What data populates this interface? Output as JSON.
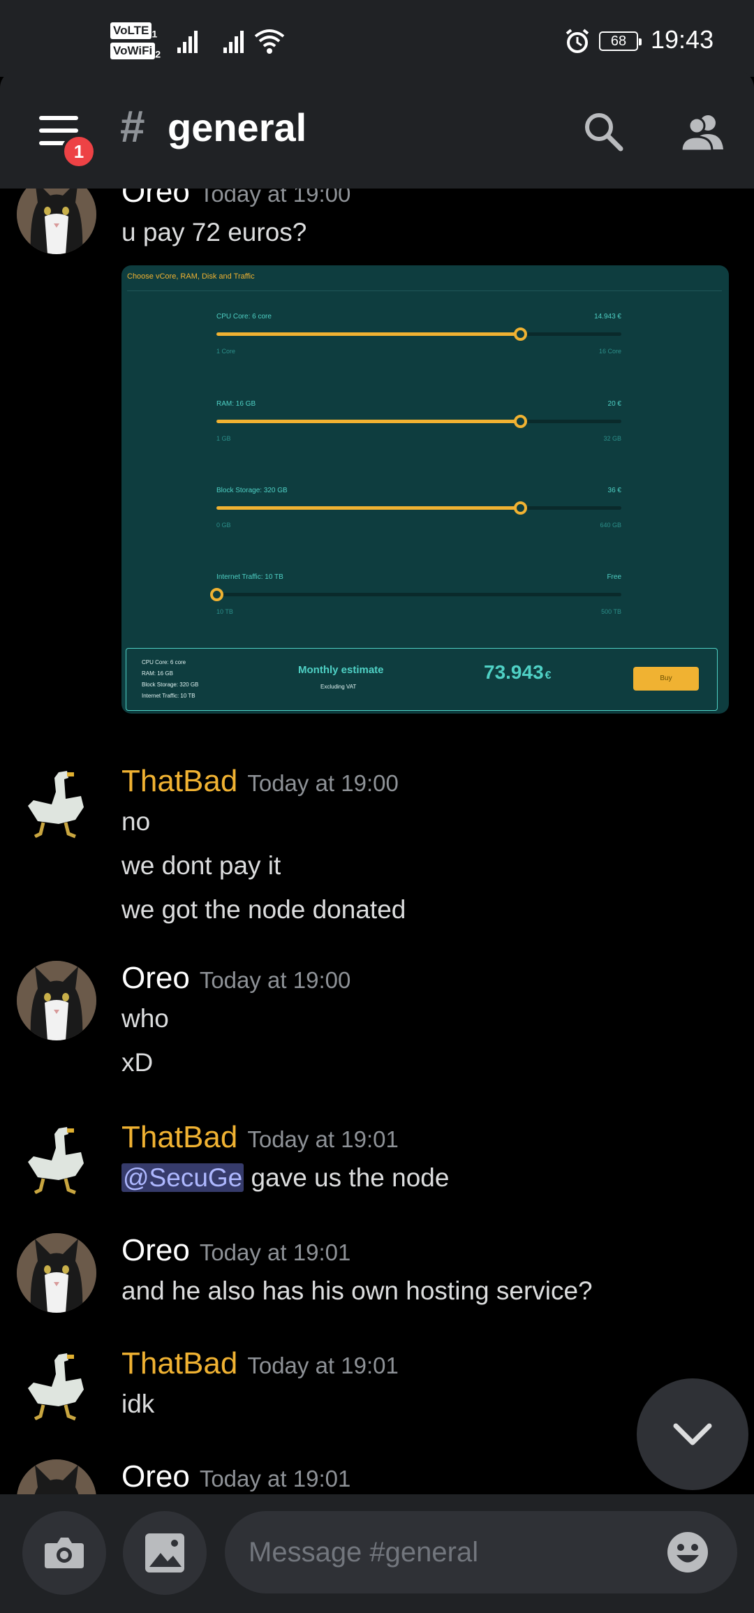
{
  "status_bar": {
    "time": "19:43",
    "battery": "68",
    "volte": "VoLTE",
    "vowifi": "VoWiFi",
    "sim1": "1",
    "sim2": "2"
  },
  "header": {
    "channel_hash": "#",
    "channel_name": "general",
    "notification_count": "1"
  },
  "messages": [
    {
      "author": "Oreo",
      "author_color": "#ffffff",
      "timestamp": "Today at 19:00",
      "lines": [
        "u pay 72 euros?"
      ],
      "attachment": {
        "title": "Choose vCore, RAM, Disk and Traffic",
        "sliders": [
          {
            "label": "CPU Core: 6 core",
            "price": "14.943 €",
            "min": "1 Core",
            "max": "16 Core",
            "fraction": 0.75
          },
          {
            "label": "RAM: 16 GB",
            "price": "20 €",
            "min": "1 GB",
            "max": "32 GB",
            "fraction": 0.75
          },
          {
            "label": "Block Storage: 320 GB",
            "price": "36 €",
            "min": "0 GB",
            "max": "640 GB",
            "fraction": 0.75
          },
          {
            "label": "Internet Traffic: 10 TB",
            "price": "Free",
            "min": "10 TB",
            "max": "500 TB",
            "fraction": 0.0
          }
        ],
        "summary": [
          "CPU Core: 6 core",
          "RAM: 16 GB",
          "Block Storage: 320 GB",
          "Internet Traffic: 10 TB"
        ],
        "estimate_title": "Monthly estimate",
        "estimate_sub": "Excluding VAT",
        "estimate_price": "73.943",
        "estimate_currency": "€",
        "buy_label": "Buy"
      }
    },
    {
      "author": "ThatBad",
      "author_color": "#f0b232",
      "timestamp": "Today at 19:00",
      "lines": [
        "no",
        "we dont pay it",
        "we got the node donated"
      ]
    },
    {
      "author": "Oreo",
      "author_color": "#ffffff",
      "timestamp": "Today at 19:00",
      "lines": [
        "who",
        "xD"
      ]
    },
    {
      "author": "ThatBad",
      "author_color": "#f0b232",
      "timestamp": "Today at 19:01",
      "mention": "@SecuGe",
      "lines": [
        "gave us the node"
      ]
    },
    {
      "author": "Oreo",
      "author_color": "#ffffff",
      "timestamp": "Today at 19:01",
      "lines": [
        "and he also has his own hosting service?"
      ]
    },
    {
      "author": "ThatBad",
      "author_color": "#f0b232",
      "timestamp": "Today at 19:01",
      "lines": [
        "idk"
      ]
    },
    {
      "author": "Oreo",
      "author_color": "#ffffff",
      "timestamp": "Today at 19:01",
      "lines": []
    }
  ],
  "composer": {
    "placeholder": "Message #general"
  },
  "icons": {
    "menu": "hamburger-icon",
    "search": "search-icon",
    "members": "members-icon",
    "camera": "camera-icon",
    "gallery": "image-icon",
    "emoji": "emoji-icon",
    "jump": "chevron-down-icon"
  }
}
